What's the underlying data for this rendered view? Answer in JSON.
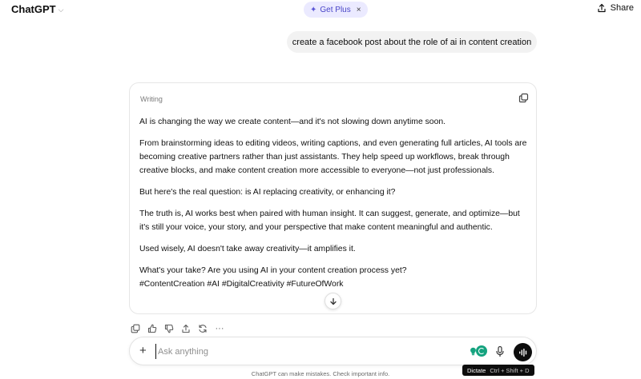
{
  "header": {
    "app_title": "ChatGPT",
    "get_plus_label": "Get Plus",
    "share_label": "Share"
  },
  "conversation": {
    "user_message": "create a facebook post about the role of ai in content creation",
    "response_label": "Writing",
    "paragraphs": [
      "AI is changing the way we create content—and it's not slowing down anytime soon.",
      "From brainstorming ideas to editing videos, writing captions, and even generating full articles, AI tools are becoming creative partners rather than just assistants. They help speed up workflows, break through creative blocks, and make content creation more accessible to everyone—not just professionals.",
      "But here's the real question: is AI replacing creativity, or enhancing it?",
      "The truth is, AI works best when paired with human insight. It can suggest, generate, and optimize—but it's still your voice, your story, and your perspective that make content meaningful and authentic.",
      "Used wisely, AI doesn't take away creativity—it amplifies it.",
      "What's your take? Are you using AI in your content creation process yet?"
    ],
    "hashtags": "#ContentCreation #AI #DigitalCreativity #FutureOfWork"
  },
  "composer": {
    "placeholder": "Ask anything"
  },
  "tooltip": {
    "label": "Dictate",
    "shortcut": "Ctrl + Shift + D"
  },
  "footer": {
    "disclaimer": "ChatGPT can make mistakes. Check important info."
  },
  "icons": {
    "copy": "copy-icon",
    "thumbs_up": "thumbs-up-icon",
    "thumbs_down": "thumbs-down-icon",
    "share": "share-icon",
    "regenerate": "regenerate-icon",
    "more": "more-icon",
    "microphone": "microphone-icon",
    "voice": "voice-mode-icon"
  },
  "colors": {
    "accent": "#5b57d6",
    "get_plus_bg": "#ebeaff",
    "extension_green": "#15a37f"
  }
}
